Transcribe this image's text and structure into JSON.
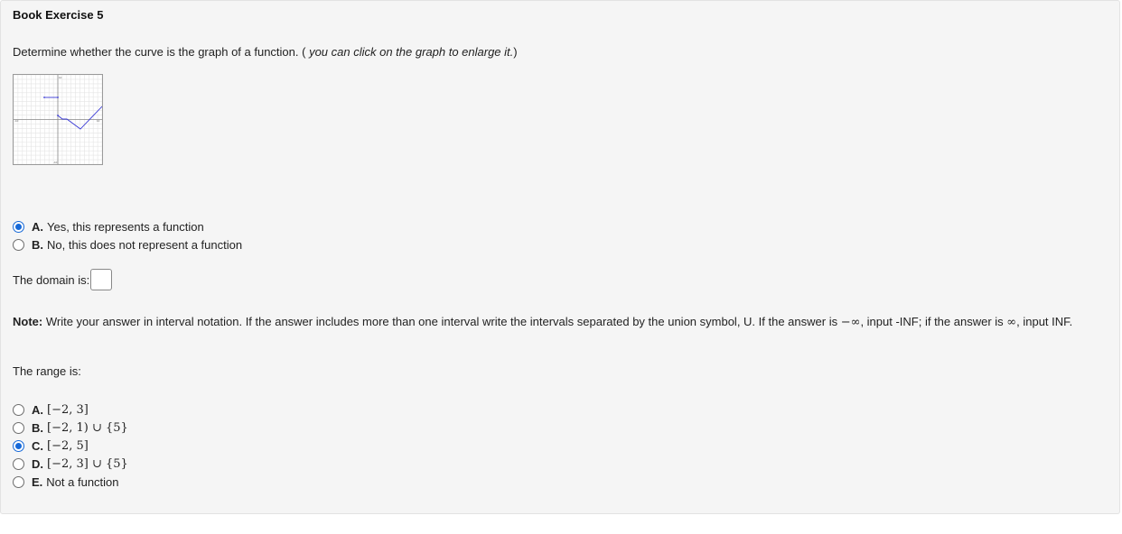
{
  "exercise": {
    "title": "Book Exercise 5",
    "question": "Determine whether the curve is the graph of a function. (",
    "question_hint": " you can click on the graph to enlarge it.",
    "question_close": ")"
  },
  "graph": {
    "axis_labels": {
      "x_neg": "-10",
      "x_pos": "10",
      "y_pos": "10",
      "y_neg": "-10"
    }
  },
  "function_question": {
    "options": [
      {
        "letter": "A.",
        "text": "Yes, this represents a function",
        "selected": true
      },
      {
        "letter": "B.",
        "text": "No, this does not represent a function",
        "selected": false
      }
    ]
  },
  "domain": {
    "label": "The domain is:",
    "value": ""
  },
  "note": {
    "label": "Note:",
    "text_1": " Write your answer in interval notation. If the answer includes more than one interval write the intervals separated by the union symbol, U. If the answer is ",
    "neg_inf": "−∞",
    "text_2": ", input -INF; if the answer is ",
    "pos_inf": "∞",
    "text_3": ", input INF."
  },
  "range": {
    "label": "The range is:",
    "options": [
      {
        "letter": "A.",
        "text": "[−2, 3]",
        "math": true,
        "selected": false
      },
      {
        "letter": "B.",
        "text": "[−2, 1) ∪ {5}",
        "math": true,
        "selected": false
      },
      {
        "letter": "C.",
        "text": "[−2, 5]",
        "math": true,
        "selected": true
      },
      {
        "letter": "D.",
        "text": "[−2, 3] ∪ {5}",
        "math": true,
        "selected": false
      },
      {
        "letter": "E.",
        "text": "Not a function",
        "math": false,
        "selected": false
      }
    ]
  },
  "colors": {
    "accent": "#1769d8",
    "graph_line": "#3a3ad6",
    "panel_bg": "#f5f5f5"
  }
}
